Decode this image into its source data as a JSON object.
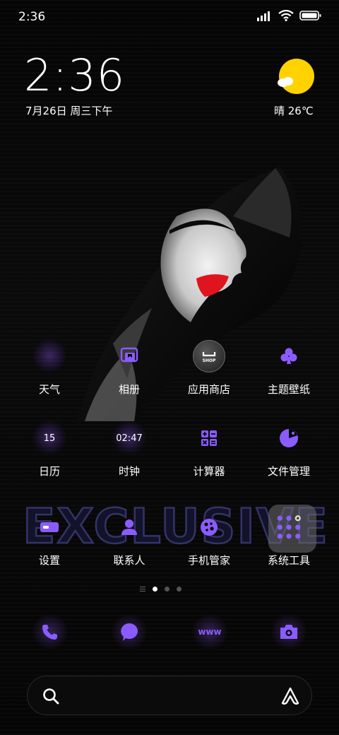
{
  "status_bar": {
    "time": "2:36"
  },
  "clock_widget": {
    "time": "2:36",
    "date": "7月26日 周三下午"
  },
  "weather_widget": {
    "text": "晴 26℃",
    "icon": "sunny-cloud-icon"
  },
  "wallpaper": {
    "banner_text": "EXCLUSIVE"
  },
  "apps": [
    {
      "label": "天气",
      "icon": "weather-icon"
    },
    {
      "label": "相册",
      "icon": "gallery-icon"
    },
    {
      "label": "应用商店",
      "icon": "shop-icon",
      "icon_text": "SHOP"
    },
    {
      "label": "主题壁纸",
      "icon": "club-icon"
    },
    {
      "label": "日历",
      "icon": "calendar-icon",
      "icon_text": "15"
    },
    {
      "label": "时钟",
      "icon": "clock-icon",
      "icon_text": "02:47"
    },
    {
      "label": "计算器",
      "icon": "calculator-icon"
    },
    {
      "label": "文件管理",
      "icon": "file-manager-icon"
    },
    {
      "label": "设置",
      "icon": "settings-icon"
    },
    {
      "label": "联系人",
      "icon": "contacts-icon"
    },
    {
      "label": "手机管家",
      "icon": "security-icon"
    },
    {
      "label": "系统工具",
      "icon": "tools-folder-icon"
    }
  ],
  "dock": [
    {
      "icon": "phone-icon"
    },
    {
      "icon": "messages-icon"
    },
    {
      "icon": "browser-icon",
      "icon_text": "www"
    },
    {
      "icon": "camera-icon"
    }
  ],
  "pager": {
    "pages": 3,
    "active": 0
  },
  "colors": {
    "accent": "#8a5cff",
    "sun": "#ffd200",
    "lips": "#e0141e"
  }
}
